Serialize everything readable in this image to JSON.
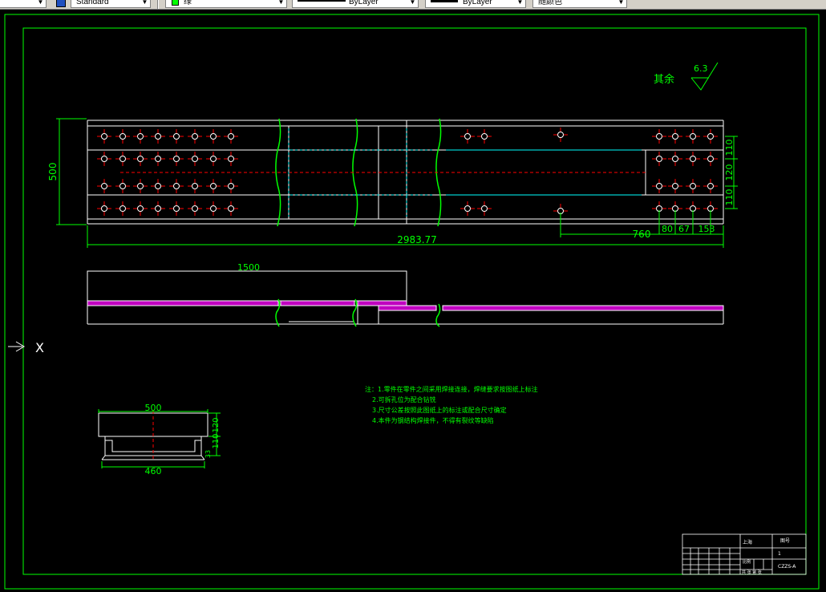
{
  "toolbar": {
    "text_style": "Standard",
    "layer_color_name": "绿",
    "linetype": "ByLayer",
    "lineweight": "ByLayer",
    "plot_color": "随颜色"
  },
  "colors": {
    "background": "#000000",
    "outline": "#00ff00",
    "hidden": "#ff0000",
    "center": "#00ffff",
    "section": "#ff00ff",
    "lines": "#ffffff"
  },
  "drawing": {
    "surface_label": "其余",
    "roughness_value": "6.3",
    "top_view": {
      "overall_width": "500",
      "overall_length": "2983.77",
      "dim_760": "760",
      "dim_80": "80",
      "dim_67": "67",
      "dim_153": "153",
      "dim_110_top": "110",
      "dim_120": "120",
      "dim_110_bottom": "110"
    },
    "side_view": {
      "section_length": "1500"
    },
    "section_view": {
      "top_width": "500",
      "bottom_width": "460",
      "dim_120": "120",
      "dim_110": "110",
      "dim_33": "33"
    },
    "notes": {
      "line1": "注：1.零件在零件之间采用焊接连接，焊缝要求按图纸上标注",
      "line2": "2.可拆孔位为配合钻铣",
      "line3": "3.尺寸公差按照此图纸上的标注或配合尺寸确定",
      "line4": "4.本件为钢结构焊接件，不得有裂纹等缺陷"
    },
    "ucs_label": "X",
    "title_block": {
      "cell_a": "上海",
      "cell_b": "比例",
      "cell_c": "图号",
      "cell_d": "1",
      "cell_e": "CZZS-A",
      "cell_f": "共 张 第 张"
    }
  }
}
